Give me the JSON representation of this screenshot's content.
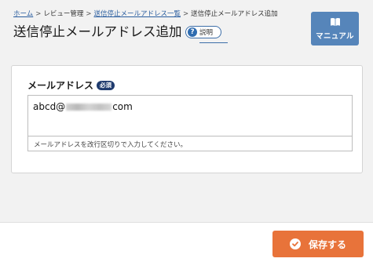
{
  "breadcrumb": {
    "home": "ホーム",
    "separator": ">",
    "review": "レビュー管理",
    "list": "送信停止メールアドレス一覧",
    "current": "送信停止メールアドレス追加"
  },
  "page": {
    "title": "送信停止メールアドレス追加",
    "help_label": "説明",
    "help_icon": "?"
  },
  "manual_button": {
    "label": "マニュアル",
    "icon": "book-icon"
  },
  "form": {
    "email_label": "メールアドレス",
    "required_badge": "必須",
    "email_prefix": "abcd@",
    "email_suffix": "com",
    "hint": "メールアドレスを改行区切りで入力してください。"
  },
  "footer": {
    "save_label": "保存する",
    "save_icon": "check-circle-icon"
  },
  "colors": {
    "accent_button": "#e8733a",
    "manual_button": "#5685ba",
    "link": "#2a5d9f",
    "required_badge": "#1f3b6e",
    "background": "#f2f2f2"
  }
}
